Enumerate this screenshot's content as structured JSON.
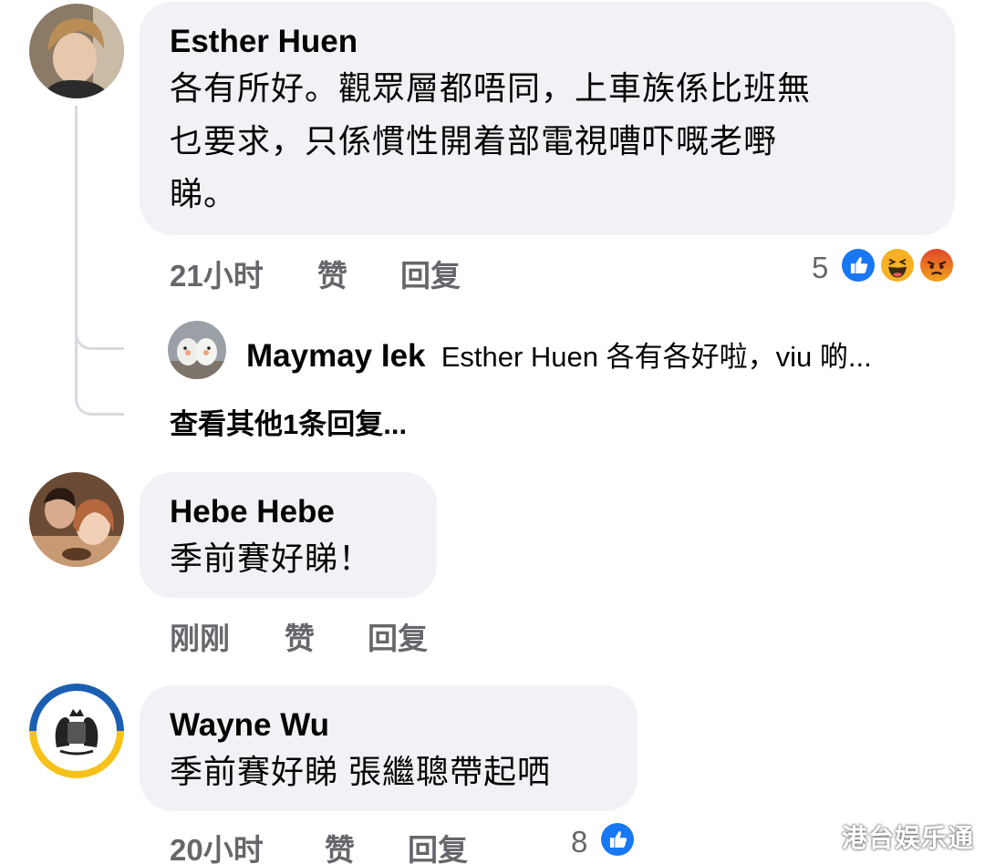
{
  "comments": [
    {
      "author": "Esther Huen",
      "text_lines": [
        "各有所好。觀眾層都唔同，上車族係比班無",
        "乜要求，只係慣性開着部電視嘈吓嘅老嘢",
        "睇。"
      ],
      "time": "21小时",
      "like_label": "赞",
      "reply_label": "回复",
      "reaction_count": "5",
      "reactions": [
        "like-icon",
        "haha-icon",
        "angry-icon"
      ],
      "reply_preview": {
        "author": "Maymay Iek",
        "text": "Esther Huen 各有各好啦，viu 啲..."
      },
      "more_replies_label": "查看其他1条回复..."
    },
    {
      "author": "Hebe Hebe",
      "text_lines": [
        "季前賽好睇！"
      ],
      "time": "刚刚",
      "like_label": "赞",
      "reply_label": "回复"
    },
    {
      "author": "Wayne Wu",
      "text_lines": [
        "季前賽好睇 張繼聰帶起哂"
      ],
      "time": "20小时",
      "like_label": "赞",
      "reply_label": "回复",
      "reaction_count": "8",
      "reactions": [
        "like-icon"
      ]
    }
  ],
  "watermark": "港台娱乐通",
  "colors": {
    "bubble": "#f0f2f5",
    "meta_text": "#65676b",
    "like_blue": "#1877f2",
    "haha_yellow": "#f7b125",
    "angry_orange": "#e9710f"
  }
}
